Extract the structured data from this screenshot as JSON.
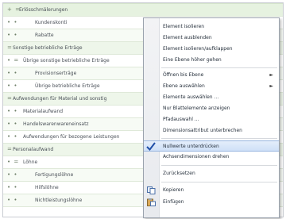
{
  "tree": {
    "rows": [
      {
        "mark": "+ =",
        "label": "Erlösschmälerungen"
      },
      {
        "mark": "• •",
        "label": "Kundenskonti"
      },
      {
        "mark": "• •",
        "label": "Rabatte"
      },
      {
        "mark": "=",
        "label": "Sonstige betriebliche Erträge"
      },
      {
        "mark": "• =",
        "label": "Übrige sonstige betriebliche Erträge"
      },
      {
        "mark": "• •",
        "label": "Provisionserträge"
      },
      {
        "mark": "• •",
        "label": "Übrige betriebliche Erträge"
      },
      {
        "mark": "=",
        "label": "Aufwendungen für Material und sonstig"
      },
      {
        "mark": "• •",
        "label": "Materialaufwand"
      },
      {
        "mark": "• •",
        "label": "Handelswarenwareneinsatz"
      },
      {
        "mark": "• •",
        "label": "Aufwendungen für bezogene Leistungen"
      },
      {
        "mark": "=",
        "label": "Personalaufwand"
      },
      {
        "mark": "• =",
        "label": "Löhne"
      },
      {
        "mark": "• •",
        "label": "Fertigungslöhne"
      },
      {
        "mark": "• •",
        "label": "Hilfslöhne"
      },
      {
        "mark": "• •",
        "label": "Nichtleistungslöhne"
      }
    ]
  },
  "context_menu": {
    "items": [
      {
        "label": "Element isolieren"
      },
      {
        "label": "Element ausblenden"
      },
      {
        "label": "Element isolieren/aufklappen"
      },
      {
        "label": "Eine Ebene höher gehen"
      },
      {
        "label": "Öffnen bis Ebene",
        "submenu": true
      },
      {
        "label": "Ebene auswählen",
        "submenu": true
      },
      {
        "label": "Elemente auswählen ..."
      },
      {
        "label": "Nur Blattelemente anzeigen"
      },
      {
        "label": "Pfadauswahl ..."
      },
      {
        "label": "Dimensionsattribut unterbrechen"
      },
      {
        "label": "Nullwerte unterdrücken",
        "checked": true,
        "highlighted": true
      },
      {
        "label": "Achsendimensionen drehen"
      },
      {
        "label": "Zurücksetzen"
      },
      {
        "label": "Kopieren",
        "icon": "copy-icon"
      },
      {
        "label": "Einfügen",
        "icon": "paste-icon"
      }
    ],
    "submenu_arrow": "►"
  },
  "colors": {
    "menu_highlight": "#cfe0f7",
    "row_tint": "#f7fbf5",
    "checkmark": "#1f4fa8"
  }
}
